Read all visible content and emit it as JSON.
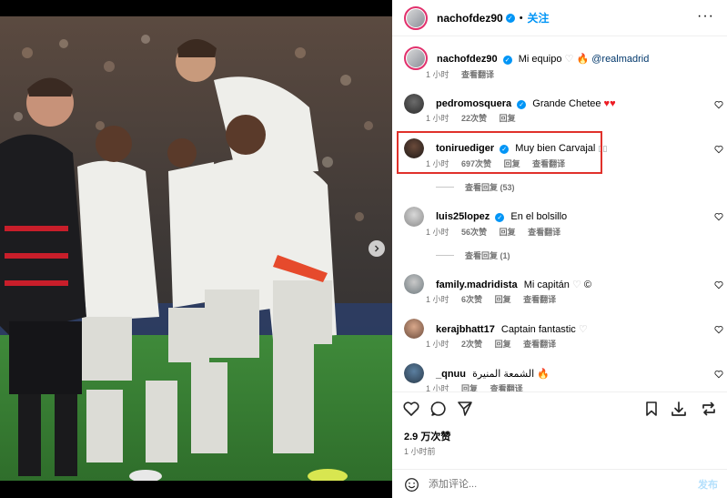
{
  "header": {
    "username": "nachofdez90",
    "dot": "•",
    "follow_label": "关注",
    "more_icon": "more-horizontal-icon"
  },
  "caption": {
    "username": "nachofdez90",
    "text": "Mi equipo",
    "mention": "@realmadrid",
    "time": "1 小时",
    "translate": "查看翻译"
  },
  "comments": [
    {
      "username": "pedromosquera",
      "verified": true,
      "text": "Grande Chetee",
      "time": "1 小时",
      "likes": "22次赞",
      "reply": "回复",
      "translate": ""
    },
    {
      "username": "toniruediger",
      "verified": true,
      "text": "Muy bien Carvajal",
      "time": "1 小时",
      "likes": "697次赞",
      "reply": "回复",
      "translate": "查看翻译",
      "replies": "查看回复 (53)"
    },
    {
      "username": "luis25lopez",
      "verified": true,
      "text": "En el bolsillo",
      "time": "1 小时",
      "likes": "56次赞",
      "reply": "回复",
      "translate": "查看翻译",
      "replies": "查看回复 (1)"
    },
    {
      "username": "family.madridista",
      "verified": false,
      "text": "Mi capitán",
      "suffix": "©",
      "time": "1 小时",
      "likes": "6次赞",
      "reply": "回复",
      "translate": "查看翻译"
    },
    {
      "username": "kerajbhatt17",
      "verified": false,
      "text": "Captain fantastic",
      "time": "1 小时",
      "likes": "2次赞",
      "reply": "回复",
      "translate": "查看翻译"
    },
    {
      "username": "_qnuu",
      "verified": false,
      "text": "الشمعة المنيرة",
      "time": "1 小时",
      "likes": "",
      "reply": "回复",
      "translate": "查看翻译"
    }
  ],
  "footer": {
    "likes": "2.9 万次赞",
    "time": "1 小时前",
    "comment_placeholder": "添加评论...",
    "post_label": "发布"
  },
  "colors": {
    "accent": "#0095f6",
    "highlight": "#e0312b",
    "heart_red": "#ed1c24"
  }
}
